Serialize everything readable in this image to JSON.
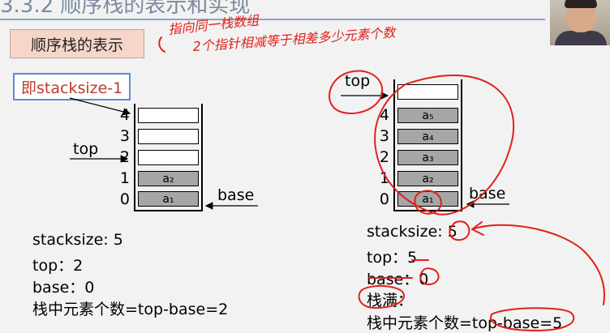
{
  "slide": {
    "title": "3.3.2 顺序栈的表示和实现",
    "section_label": "顺序栈的表示",
    "callout": "即stacksize-1"
  },
  "left_stack": {
    "indices": [
      "4",
      "3",
      "2",
      "1",
      "0"
    ],
    "cells": [
      {
        "label": "",
        "filled": false
      },
      {
        "label": "",
        "filled": false
      },
      {
        "label": "",
        "filled": false
      },
      {
        "label": "a₂",
        "filled": true
      },
      {
        "label": "a₁",
        "filled": true
      }
    ],
    "top_label": "top",
    "base_label": "base",
    "info": [
      "stacksize: 5",
      "top：2",
      "base：0",
      "栈中元素个数=top-base=2"
    ]
  },
  "right_stack": {
    "indices": [
      "4",
      "3",
      "2",
      "1",
      "0"
    ],
    "cells": [
      {
        "label": "a₅",
        "filled": true
      },
      {
        "label": "a₄",
        "filled": true
      },
      {
        "label": "a₃",
        "filled": true
      },
      {
        "label": "a₂",
        "filled": true
      },
      {
        "label": "a₁",
        "filled": true
      }
    ],
    "top_label": "top",
    "base_label": "base",
    "info": [
      "stacksize: 5",
      "top：5",
      "base：0",
      "栈满：",
      "栈中元素个数=top-base=5"
    ]
  },
  "annotation": {
    "handwritten_line1": "指向同一栈数组",
    "handwritten_line2": "2个指针相减等于相差多少元素个数",
    "ink_color": "#e0201b"
  },
  "colors": {
    "filled_cell": "#a6a6a6",
    "section_bg": "#f5d6c9",
    "callout_border": "#5b8ec9",
    "callout_text": "#c0392b"
  }
}
